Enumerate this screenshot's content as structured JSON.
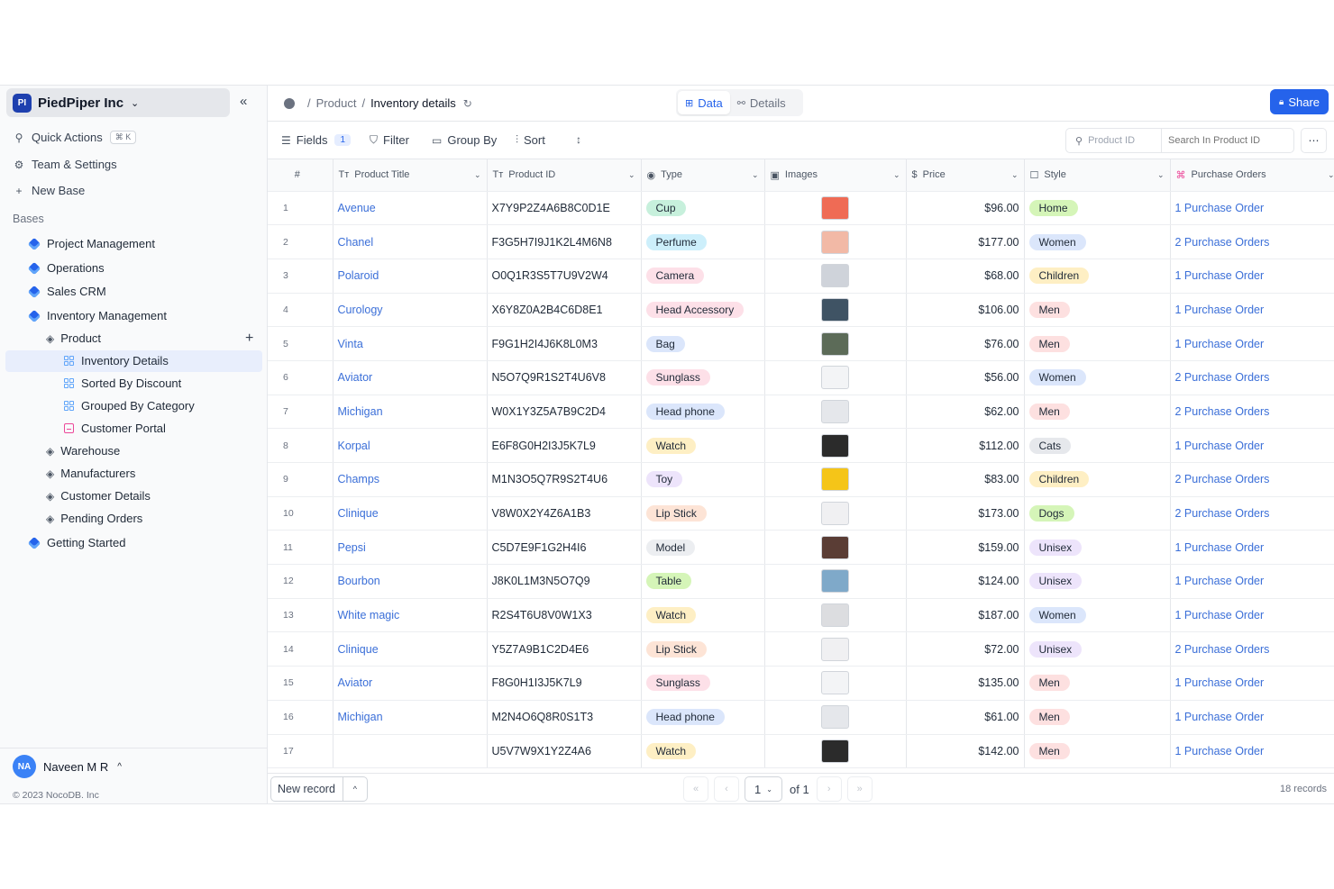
{
  "workspace": {
    "badge": "PI",
    "name": "PiedPiper Inc"
  },
  "sidebar": {
    "quick_actions": "Quick Actions",
    "shortcut": "⌘ K",
    "team_settings": "Team & Settings",
    "new_base": "New Base",
    "bases_label": "Bases",
    "bases": [
      "Project Management",
      "Operations",
      "Sales CRM",
      "Inventory Management"
    ],
    "table_product": "Product",
    "views": [
      "Inventory Details",
      "Sorted By Discount",
      "Grouped By Category",
      "Customer Portal"
    ],
    "tables": [
      "Warehouse",
      "Manufacturers",
      "Customer Details",
      "Pending Orders"
    ],
    "getting_started": "Getting Started"
  },
  "user": {
    "initials": "NA",
    "name": "Naveen M R"
  },
  "copyright": "© 2023 NocoDB. Inc",
  "breadcrumb": {
    "sep": "/",
    "product": "Product",
    "current": "Inventory details"
  },
  "tabs": {
    "data": "Data",
    "details": "Details"
  },
  "share_label": "Share",
  "toolbar": {
    "fields": "Fields",
    "fields_count": "1",
    "filter": "Filter",
    "group_by": "Group By",
    "sort": "Sort"
  },
  "search": {
    "field": "Product ID",
    "placeholder": "Search In Product ID"
  },
  "columns": {
    "num": "#",
    "title": "Product Title",
    "pid": "Product ID",
    "type": "Type",
    "images": "Images",
    "price": "Price",
    "style": "Style",
    "po": "Purchase Orders"
  },
  "colors": {
    "accent": "#2563eb",
    "link": "#3b6fd8"
  },
  "rows": [
    {
      "n": "1",
      "title": "Avenue",
      "pid": "X7Y9P2Z4A6B8C0D1E",
      "type": "Cup",
      "type_color": "#c7f0dc",
      "img_color": "#ef6b55",
      "price": "$96.00",
      "style": "Home",
      "style_color": "#d5f5b8",
      "po": "1 Purchase Order"
    },
    {
      "n": "2",
      "title": "Chanel",
      "pid": "F3G5H7I9J1K2L4M6N8",
      "type": "Perfume",
      "type_color": "#cdeffb",
      "img_color": "#f2b9a6",
      "price": "$177.00",
      "style": "Women",
      "style_color": "#dbe6fb",
      "po": "2 Purchase Orders"
    },
    {
      "n": "3",
      "title": "Polaroid",
      "pid": "O0Q1R3S5T7U9V2W4",
      "type": "Camera",
      "type_color": "#fde0e8",
      "img_color": "#cfd3da",
      "price": "$68.00",
      "style": "Children",
      "style_color": "#feefc4",
      "po": "1 Purchase Order"
    },
    {
      "n": "4",
      "title": "Curology",
      "pid": "X6Y8Z0A2B4C6D8E1",
      "type": "Head Accessory",
      "type_color": "#fde0e8",
      "img_color": "#3f5364",
      "price": "$106.00",
      "style": "Men",
      "style_color": "#fde0e0",
      "po": "1 Purchase Order"
    },
    {
      "n": "5",
      "title": "Vinta",
      "pid": "F9G1H2I4J6K8L0M3",
      "type": "Bag",
      "type_color": "#dbe6fb",
      "img_color": "#5c6b58",
      "price": "$76.00",
      "style": "Men",
      "style_color": "#fde0e0",
      "po": "1 Purchase Order"
    },
    {
      "n": "6",
      "title": "Aviator",
      "pid": "N5O7Q9R1S2T4U6V8",
      "type": "Sunglass",
      "type_color": "#fde0e8",
      "img_color": "#f3f4f6",
      "price": "$56.00",
      "style": "Women",
      "style_color": "#dbe6fb",
      "po": "2 Purchase Orders"
    },
    {
      "n": "7",
      "title": "Michigan",
      "pid": "W0X1Y3Z5A7B9C2D4",
      "type": "Head phone",
      "type_color": "#dbe6fb",
      "img_color": "#e5e7eb",
      "price": "$62.00",
      "style": "Men",
      "style_color": "#fde0e0",
      "po": "2 Purchase Orders"
    },
    {
      "n": "8",
      "title": "Korpal",
      "pid": "E6F8G0H2I3J5K7L9",
      "type": "Watch",
      "type_color": "#feefc4",
      "img_color": "#2b2b2b",
      "price": "$112.00",
      "style": "Cats",
      "style_color": "#e6e8ec",
      "po": "1 Purchase Order"
    },
    {
      "n": "9",
      "title": "Champs",
      "pid": "M1N3O5Q7R9S2T4U6",
      "type": "Toy",
      "type_color": "#ede4fb",
      "img_color": "#f5c518",
      "price": "$83.00",
      "style": "Children",
      "style_color": "#feefc4",
      "po": "2 Purchase Orders"
    },
    {
      "n": "10",
      "title": "Clinique",
      "pid": "V8W0X2Y4Z6A1B3",
      "type": "Lip Stick",
      "type_color": "#fde4d6",
      "img_color": "#f0f0f2",
      "price": "$173.00",
      "style": "Dogs",
      "style_color": "#d5f5b8",
      "po": "2 Purchase Orders"
    },
    {
      "n": "11",
      "title": "Pepsi",
      "pid": "C5D7E9F1G2H4I6",
      "type": "Model",
      "type_color": "#eceef1",
      "img_color": "#5a3d35",
      "price": "$159.00",
      "style": "Unisex",
      "style_color": "#ede4fb",
      "po": "1 Purchase Order"
    },
    {
      "n": "12",
      "title": "Bourbon",
      "pid": "J8K0L1M3N5O7Q9",
      "type": "Table",
      "type_color": "#d5f5b8",
      "img_color": "#7fa9c9",
      "price": "$124.00",
      "style": "Unisex",
      "style_color": "#ede4fb",
      "po": "1 Purchase Order"
    },
    {
      "n": "13",
      "title": "White magic",
      "pid": "R2S4T6U8V0W1X3",
      "type": "Watch",
      "type_color": "#feefc4",
      "img_color": "#dcdde0",
      "price": "$187.00",
      "style": "Women",
      "style_color": "#dbe6fb",
      "po": "1 Purchase Order"
    },
    {
      "n": "14",
      "title": "Clinique",
      "pid": "Y5Z7A9B1C2D4E6",
      "type": "Lip Stick",
      "type_color": "#fde4d6",
      "img_color": "#f0f0f2",
      "price": "$72.00",
      "style": "Unisex",
      "style_color": "#ede4fb",
      "po": "2 Purchase Orders"
    },
    {
      "n": "15",
      "title": "Aviator",
      "pid": "F8G0H1I3J5K7L9",
      "type": "Sunglass",
      "type_color": "#fde0e8",
      "img_color": "#f3f4f6",
      "price": "$135.00",
      "style": "Men",
      "style_color": "#fde0e0",
      "po": "1 Purchase Order"
    },
    {
      "n": "16",
      "title": "Michigan",
      "pid": "M2N4O6Q8R0S1T3",
      "type": "Head phone",
      "type_color": "#dbe6fb",
      "img_color": "#e5e7eb",
      "price": "$61.00",
      "style": "Men",
      "style_color": "#fde0e0",
      "po": "1 Purchase Order"
    },
    {
      "n": "17",
      "title": "",
      "pid": "U5V7W9X1Y2Z4A6",
      "type": "Watch",
      "type_color": "#feefc4",
      "img_color": "#2b2b2b",
      "price": "$142.00",
      "style": "Men",
      "style_color": "#fde0e0",
      "po": "1 Purchase Order"
    }
  ],
  "footer": {
    "new_record": "New record",
    "page": "1",
    "of": "of 1",
    "records": "18 records"
  }
}
